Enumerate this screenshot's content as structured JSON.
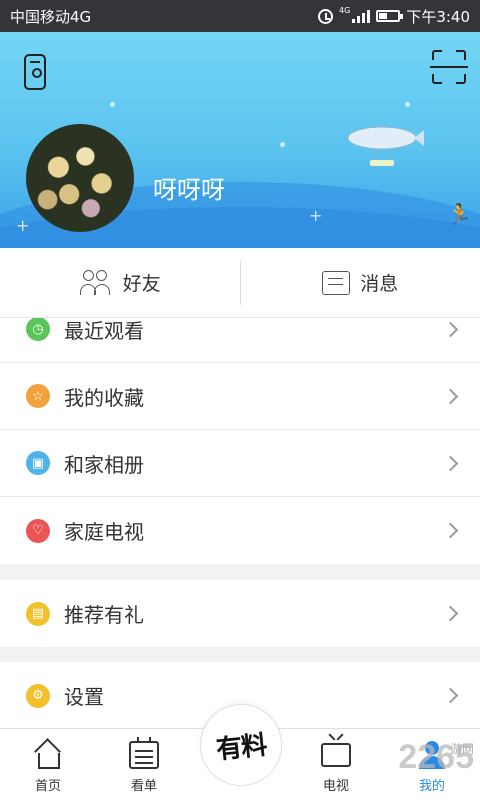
{
  "status_bar": {
    "carrier": "中国移动4G",
    "network": "4G",
    "time": "下午3:40"
  },
  "header": {
    "username": "呀呀呀"
  },
  "quick_links": [
    {
      "label": "好友",
      "icon": "friends-icon"
    },
    {
      "label": "消息",
      "icon": "message-icon"
    }
  ],
  "menu": {
    "group1": [
      {
        "label": "最近观看",
        "icon": "clock-icon",
        "color": "#5cc55a"
      },
      {
        "label": "我的收藏",
        "icon": "star-icon",
        "color": "#f2a23c"
      },
      {
        "label": "和家相册",
        "icon": "album-icon",
        "color": "#4fb2ea"
      },
      {
        "label": "家庭电视",
        "icon": "heart-icon",
        "color": "#ea5656"
      }
    ],
    "group2": [
      {
        "label": "推荐有礼",
        "icon": "gift-icon",
        "color": "#f4c02a"
      }
    ],
    "group3": [
      {
        "label": "设置",
        "icon": "gear-icon",
        "color": "#f4c02a"
      }
    ]
  },
  "tabbar": {
    "tabs": [
      {
        "label": "首页",
        "icon": "home-icon"
      },
      {
        "label": "看单",
        "icon": "calendar-icon"
      },
      {
        "label": "电视",
        "icon": "tv-icon"
      },
      {
        "label": "我的",
        "icon": "profile-icon",
        "active": true
      }
    ],
    "center_label": "有料"
  },
  "watermark": {
    "text": "2265",
    "sub": "游网"
  }
}
